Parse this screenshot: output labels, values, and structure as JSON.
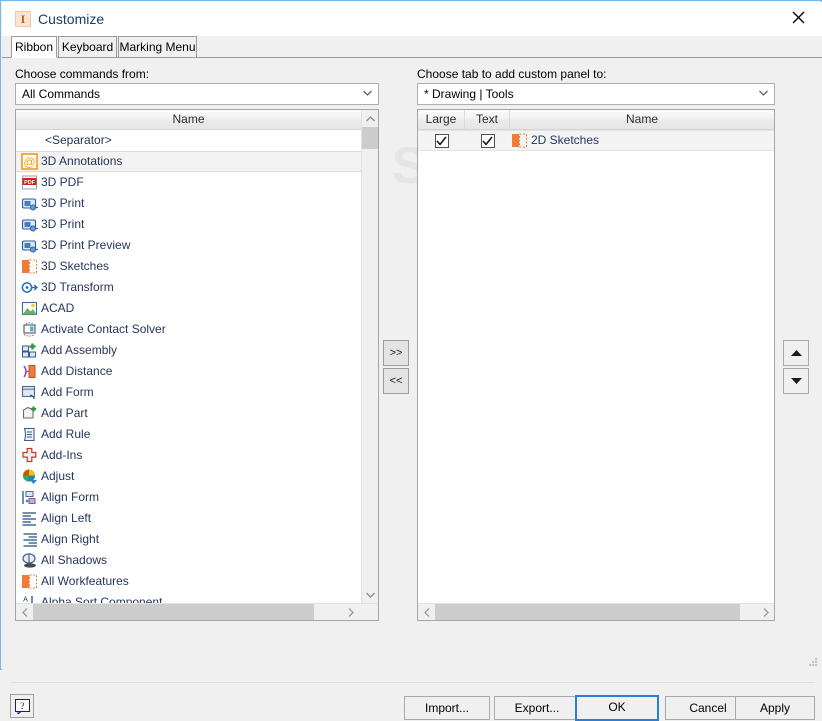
{
  "window": {
    "title": "Customize",
    "app_icon": "inventor-logo-icon",
    "icon_letter": "I",
    "close_label": "✕"
  },
  "tabs": [
    {
      "label": "Ribbon",
      "active": true
    },
    {
      "label": "Keyboard",
      "active": false
    },
    {
      "label": "Marking Menu",
      "active": false
    }
  ],
  "left_panel": {
    "label": "Choose commands from:",
    "combo_value": "All Commands",
    "column_header": "Name",
    "items": [
      {
        "label": "<Separator>",
        "icon": "none",
        "selected": false
      },
      {
        "label": "3D Annotations",
        "icon": "annotation-at-icon",
        "selected": true
      },
      {
        "label": "3D PDF",
        "icon": "pdf-icon",
        "selected": false
      },
      {
        "label": "3D Print",
        "icon": "printer-icon",
        "selected": false
      },
      {
        "label": "3D Print",
        "icon": "printer-icon",
        "selected": false
      },
      {
        "label": "3D Print Preview",
        "icon": "printer-preview-icon",
        "selected": false
      },
      {
        "label": "3D Sketches",
        "icon": "sketch-icon",
        "selected": false
      },
      {
        "label": "3D Transform",
        "icon": "transform-icon",
        "selected": false
      },
      {
        "label": "ACAD",
        "icon": "acad-icon",
        "selected": false
      },
      {
        "label": "Activate Contact Solver",
        "icon": "contact-solver-icon",
        "selected": false
      },
      {
        "label": "Add Assembly",
        "icon": "add-assembly-icon",
        "selected": false
      },
      {
        "label": "Add Distance",
        "icon": "add-distance-icon",
        "selected": false
      },
      {
        "label": "Add Form",
        "icon": "add-form-icon",
        "selected": false
      },
      {
        "label": "Add Part",
        "icon": "add-part-icon",
        "selected": false
      },
      {
        "label": "Add Rule",
        "icon": "add-rule-icon",
        "selected": false
      },
      {
        "label": "Add-Ins",
        "icon": "add-ins-icon",
        "selected": false
      },
      {
        "label": "Adjust",
        "icon": "adjust-icon",
        "selected": false
      },
      {
        "label": "Align Form",
        "icon": "align-form-icon",
        "selected": false
      },
      {
        "label": "Align Left",
        "icon": "align-left-icon",
        "selected": false
      },
      {
        "label": "Align Right",
        "icon": "align-right-icon",
        "selected": false
      },
      {
        "label": "All Shadows",
        "icon": "all-shadows-icon",
        "selected": false
      },
      {
        "label": "All Workfeatures",
        "icon": "workfeatures-icon",
        "selected": false
      },
      {
        "label": "Alpha Sort Component",
        "icon": "alpha-sort-icon",
        "selected": false
      }
    ]
  },
  "transfer": {
    "add_label": ">>",
    "remove_label": "<<"
  },
  "right_panel": {
    "label": "Choose tab to add custom panel to:",
    "combo_value": "* Drawing | Tools",
    "columns": [
      "Large",
      "Text",
      "Name"
    ],
    "rows": [
      {
        "large": true,
        "text": true,
        "name": "2D Sketches",
        "icon": "sketch-icon"
      }
    ]
  },
  "reorder": {
    "up_label": "▲",
    "down_label": "▼"
  },
  "footer": {
    "help_label": "?",
    "buttons": [
      {
        "label": "Import...",
        "default": false
      },
      {
        "label": "Export...",
        "default": false
      },
      {
        "label": "OK",
        "default": true
      },
      {
        "label": "Cancel",
        "default": false
      },
      {
        "label": "Apply",
        "default": false
      }
    ]
  },
  "watermark": {
    "text": "SOFTPEDIA"
  },
  "scroll": {
    "up_arrow": "⌃",
    "down_arrow": "⌄",
    "left_arrow": "‹",
    "right_arrow": "›"
  }
}
